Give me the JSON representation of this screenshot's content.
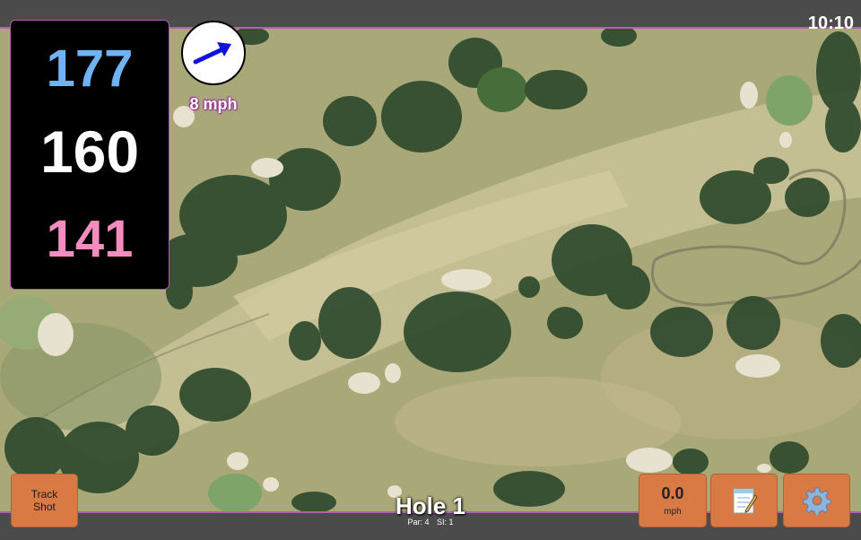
{
  "status_bar": {
    "time": "10:10"
  },
  "yardages": {
    "back": "177",
    "middle": "160",
    "front": "141",
    "colors": {
      "back": "#6fb3f2",
      "middle": "#ffffff",
      "front": "#f48cbf"
    }
  },
  "wind": {
    "speed": "8 mph",
    "direction_icon": "arrow-icon",
    "arrow_color": "#1111dd"
  },
  "hole": {
    "title": "Hole 1",
    "par": "Par: 4",
    "si": "SI: 1"
  },
  "buttons": {
    "track_shot": {
      "line1": "Track",
      "line2": "Shot"
    },
    "speed": {
      "value": "0.0",
      "unit": "mph"
    },
    "notes": {
      "icon": "notepad-icon"
    },
    "settings": {
      "icon": "gear-icon"
    }
  },
  "colors": {
    "button_bg": "#d97a45",
    "accent": "#b15fb0",
    "bar": "#4b4b4b"
  }
}
